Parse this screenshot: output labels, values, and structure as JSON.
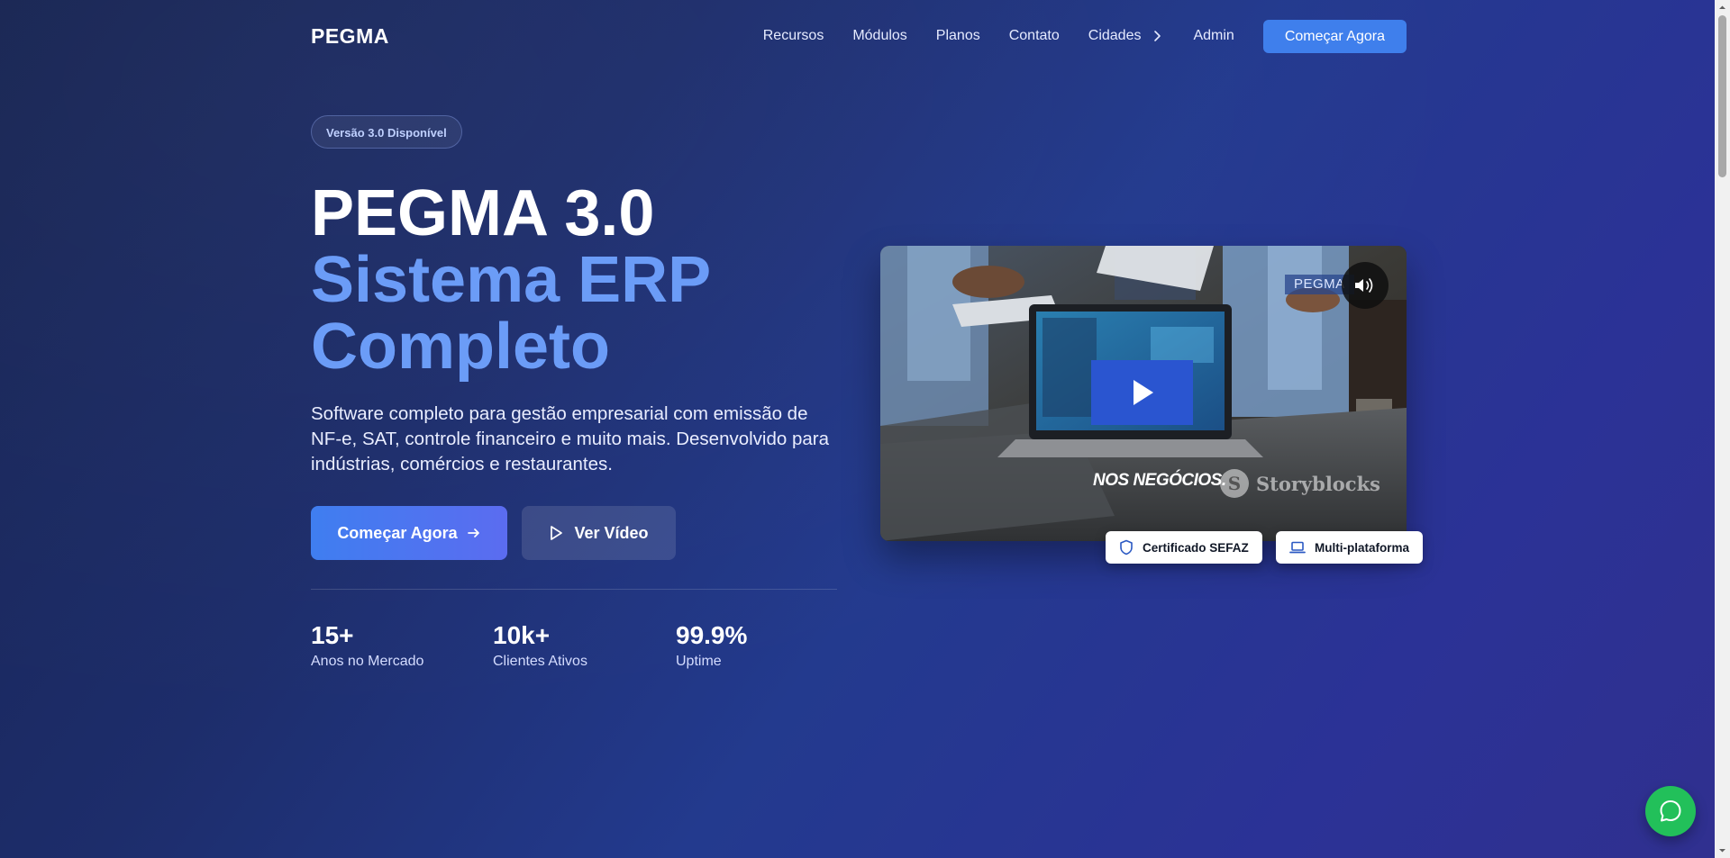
{
  "nav": {
    "logo": "PEGMA",
    "links": [
      "Recursos",
      "Módulos",
      "Planos",
      "Contato",
      "Cidades",
      "Admin"
    ],
    "cta": "Começar Agora"
  },
  "hero": {
    "badge": "Versão 3.0 Disponível",
    "title_line1": "PEGMA 3.0",
    "title_line2": "Sistema ERP",
    "title_line3": "Completo",
    "description": "Software completo para gestão empresarial com emissão de NF-e, SAT, controle financeiro e muito mais. Desenvolvido para indústrias, comércios e restaurantes.",
    "primary_button": "Começar Agora",
    "secondary_button": "Ver Vídeo",
    "stats": [
      {
        "value": "15+",
        "label": "Anos no Mercado"
      },
      {
        "value": "10k+",
        "label": "Clientes Ativos"
      },
      {
        "value": "99.9%",
        "label": "Uptime"
      }
    ]
  },
  "video": {
    "brand_overlay": "PEGMA",
    "caption": "NOS NEGÓCIOS.",
    "watermark": "Storyblocks",
    "chips": [
      "Certificado SEFAZ",
      "Multi-plataforma"
    ]
  },
  "colors": {
    "accent": "#3f7fec",
    "title_accent": "#6b9cf7",
    "whatsapp": "#22c05a"
  },
  "icons": [
    "chevron-right-icon",
    "arrow-right-icon",
    "play-icon",
    "volume-icon",
    "shield-icon",
    "laptop-icon",
    "chat-icon"
  ]
}
